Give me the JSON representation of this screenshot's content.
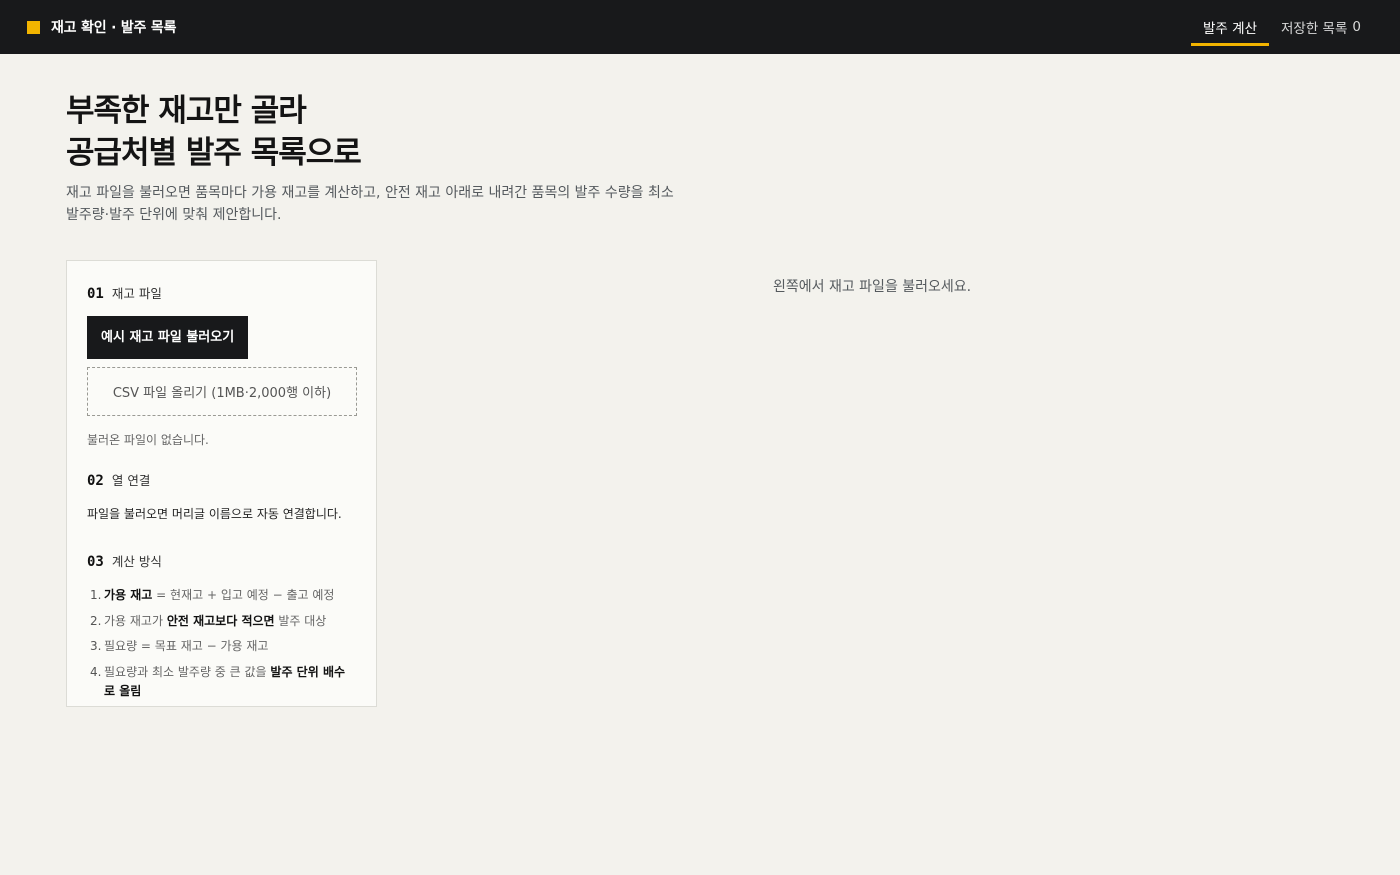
{
  "header": {
    "title": "재고 확인 · 발주 목록",
    "tabs": [
      {
        "label": "발주 계산"
      },
      {
        "label": "저장한 목록",
        "count": "0"
      }
    ]
  },
  "hero": {
    "title_line1": "부족한 재고만 골라",
    "title_line2": "공급처별 발주 목록으로",
    "description": "재고 파일을 불러오면 품목마다 가용 재고를 계산하고, 안전 재고 아래로 내려간 품목의 발주 수량을 최소 발주량·발주 단위에 맞춰 제안합니다."
  },
  "panel": {
    "step1": {
      "number": "01",
      "title": "재고 파일",
      "load_sample_button": "예시 재고 파일 불러오기",
      "upload_label": "CSV 파일 올리기 (1MB·2,000행 이하)",
      "file_status": "불러온 파일이 없습니다."
    },
    "step2": {
      "number": "02",
      "title": "열 연결",
      "note": "파일을 불러오면 머리글 이름으로 자동 연결합니다."
    },
    "step3": {
      "number": "03",
      "title": "계산 방식",
      "rules": [
        {
          "num": "1.",
          "before": "",
          "bold": "가용 재고",
          "after": " = 현재고 + 입고 예정 − 출고 예정"
        },
        {
          "num": "2.",
          "before": "가용 재고가 ",
          "bold": "안전 재고보다 적으면",
          "after": " 발주 대상"
        },
        {
          "num": "3.",
          "before": "필요량 = 목표 재고 − 가용 재고",
          "bold": "",
          "after": ""
        },
        {
          "num": "4.",
          "before": "필요량과 최소 발주량 중 큰 값을 ",
          "bold": "발주 단위 배수로 올림",
          "after": ""
        }
      ]
    }
  },
  "result": {
    "empty_message": "왼쪽에서 재고 파일을 불러오세요."
  }
}
